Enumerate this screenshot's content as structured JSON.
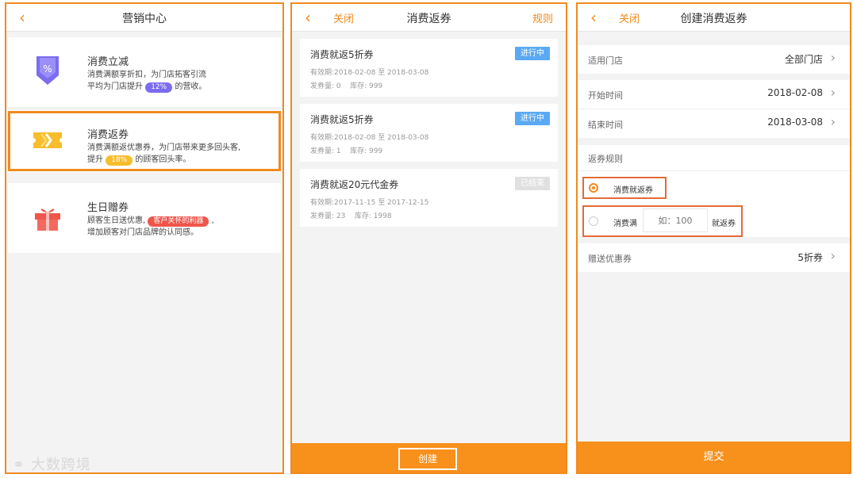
{
  "panel1": {
    "back_icon": "chevron-left-icon",
    "title": "营销中心",
    "items": [
      {
        "title": "消费立减",
        "desc_line1": "消费满额享折扣，为门店拓客引流",
        "desc_line2_prefix": "平均为门店提升",
        "pill": "12%",
        "desc_line2_suffix": "的营收。",
        "icon": "discount-percent-icon"
      },
      {
        "title": "消费返券",
        "desc_line1": "消费满额返优惠券，为门店带来更多回头客,",
        "desc_line2_prefix": "提升",
        "pill": "18%",
        "desc_line2_suffix": "的顾客回头率。",
        "icon": "ticket-icon"
      },
      {
        "title": "生日赠券",
        "desc_line1_prefix": "顾客生日送优惠,",
        "pill": "客户关怀的利器",
        "desc_line1_suffix": ",",
        "desc_line2": "增加顾客对门店品牌的认同感。",
        "icon": "gift-icon"
      }
    ],
    "watermark": "大数跨境",
    "colors": {
      "purple": "#7b6cf0",
      "yellow": "#f7bd2b",
      "red": "#f0554a"
    }
  },
  "panel2": {
    "back_icon": "chevron-left-icon",
    "close_label": "关闭",
    "title": "消费返券",
    "rules_label": "规则",
    "coupons": [
      {
        "title": "消费就返5折券",
        "validity": "有效期:2018-02-08 至 2018-03-08",
        "issued": "发券量: 0",
        "stock": "库存: 999",
        "status": "进行中",
        "status_color": "#5aa9f3"
      },
      {
        "title": "消费就返5折券",
        "validity": "有效期:2018-02-08 至 2018-03-08",
        "issued": "发券量: 1",
        "stock": "库存: 999",
        "status": "进行中",
        "status_color": "#5aa9f3"
      },
      {
        "title": "消费就返20元代金券",
        "validity": "有效期:2017-11-15 至 2017-12-15",
        "issued": "发券量: 23",
        "stock": "库存: 1998",
        "status": "已结束",
        "status_color": "#e0e0e0"
      }
    ],
    "create_label": "创建"
  },
  "panel3": {
    "back_icon": "chevron-left-icon",
    "close_label": "关闭",
    "title": "创建消费返券",
    "store_label": "适用门店",
    "store_value": "全部门店",
    "start_label": "开始时间",
    "start_value": "2018-02-08",
    "end_label": "结束时间",
    "end_value": "2018-03-08",
    "rules_header": "返券规则",
    "option1": "消费就返券",
    "option2_prefix": "消费满",
    "option2_placeholder": "如：100",
    "option2_suffix": "就返券",
    "gift_label": "赠送优惠券",
    "gift_value": "5折券",
    "submit_label": "提交",
    "accent": "#f08a1c"
  }
}
